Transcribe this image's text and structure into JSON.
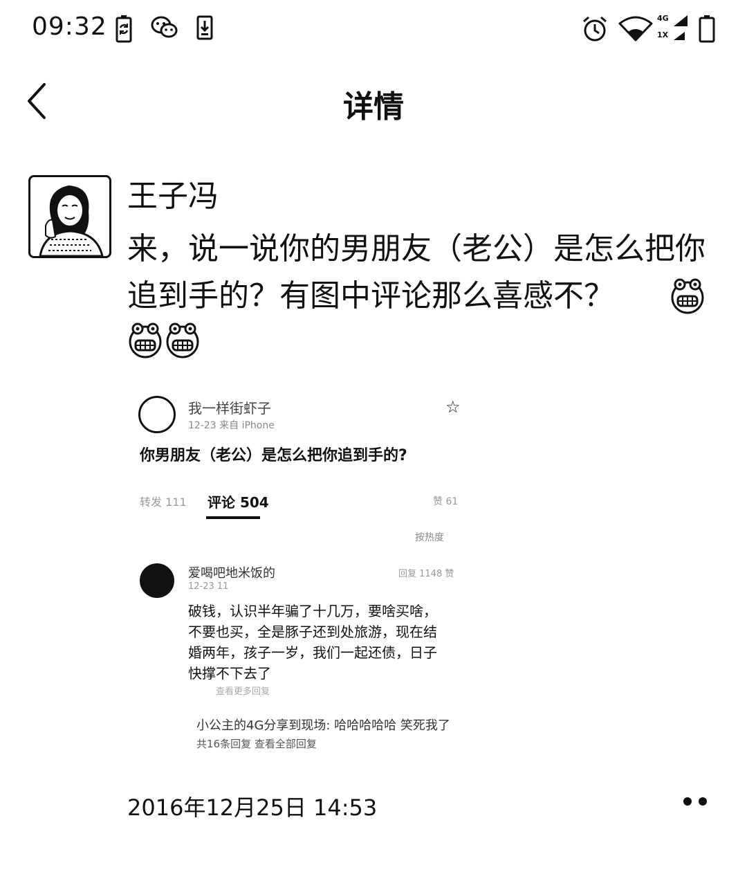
{
  "status_bar": {
    "time": "09:32",
    "icons": [
      "sync-battery-icon",
      "wechat-icon",
      "download-icon",
      "alarm-icon",
      "wifi-icon",
      "signal-4g-icon",
      "battery-icon"
    ],
    "network_top": "4G",
    "network_bottom": "1X"
  },
  "nav": {
    "title": "详情",
    "back_icon": "back-chevron-icon"
  },
  "post": {
    "author": "王子冯",
    "text": "来，说一说你的男朋友（老公）是怎么把你追到手的？有图中评论那么喜感不？",
    "emoji": [
      "grin-emoji",
      "grin-emoji",
      "grin-emoji"
    ],
    "timestamp": "2016年12月25日 14:53",
    "more_icon": "more-dots-icon"
  },
  "embedded_screenshot": {
    "author": "我一样街虾子",
    "meta": "12-23 来自 iPhone",
    "title": "你男朋友（老公）是怎么把你追到手的?",
    "tab_left": "转发 111",
    "tab_active": "评论 504",
    "tab_right": "赞 61",
    "sort": "按热度",
    "comment": {
      "name": "爱喝吧地米饭的",
      "meta": "12-23 11",
      "right": "回复 1148 赞",
      "text": "破钱，认识半年骗了十几万，要啥买啥，不要也买，全是豚子还到处旅游，现在结婚两年，孩子一岁，我们一起还债，日子快撑不下去了",
      "sub": "查看更多回复"
    },
    "footer1": "小公主的4G分享到现场: 哈哈哈哈哈 笑死我了",
    "footer2": "共16条回复 查看全部回复"
  }
}
